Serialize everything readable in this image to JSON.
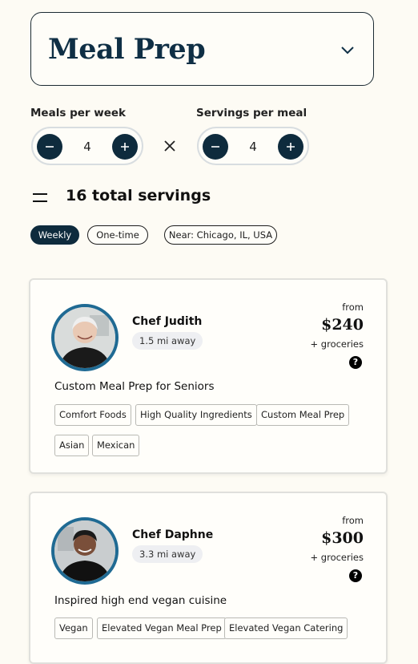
{
  "service": {
    "title": "Meal Prep",
    "dropdown_icon": "chevron-down-icon"
  },
  "meals_per_week": {
    "label": "Meals per week",
    "value": "4"
  },
  "servings_per_meal": {
    "label": "Servings per meal",
    "value": "4"
  },
  "total": {
    "text": "16 total servings"
  },
  "filters": {
    "weekly": "Weekly",
    "one_time": "One-time",
    "location": "Near: Chicago, IL, USA",
    "active": "Weekly"
  },
  "colors": {
    "accent": "#0e2b3d",
    "avatar_ring": "#1f6a93",
    "background": "#fdfbf4"
  },
  "chefs": [
    {
      "name": "Chef Judith",
      "distance": "1.5 mi away",
      "from": "from",
      "price": "$240",
      "groceries": "+ groceries",
      "tagline": "Custom Meal Prep for Seniors",
      "tags": [
        "Comfort Foods",
        "High Quality Ingredients",
        "Custom Meal Prep",
        "Asian",
        "Mexican"
      ]
    },
    {
      "name": "Chef Daphne",
      "distance": "3.3 mi away",
      "from": "from",
      "price": "$300",
      "groceries": "+ groceries",
      "tagline": "Inspired high end vegan cuisine",
      "tags": [
        "Vegan",
        "Elevated Vegan Meal Prep",
        "Elevated Vegan Catering"
      ]
    }
  ]
}
